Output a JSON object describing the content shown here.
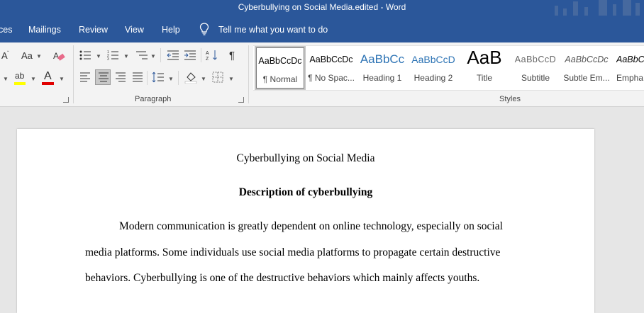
{
  "window": {
    "title": "Cyberbullying on Social Media.edited  -  Word"
  },
  "menu": {
    "tabs": [
      "ces",
      "Mailings",
      "Review",
      "View",
      "Help"
    ],
    "tell_me": "Tell me what you want to do"
  },
  "ribbon": {
    "font": {
      "grow_shrink_glyph": "A",
      "change_case_glyph": "Aa",
      "highlight_glyph": "ab",
      "font_color_glyph": "A",
      "highlight_color": "#ffff00",
      "font_color": "#e00000"
    },
    "paragraph": {
      "label": "Paragraph",
      "show_marks_glyph": "¶"
    },
    "styles": {
      "label": "Styles",
      "items": [
        {
          "sample": "AaBbCcDc",
          "name": "¶ Normal"
        },
        {
          "sample": "AaBbCcDc",
          "name": "¶ No Spac..."
        },
        {
          "sample": "AaBbCc",
          "name": "Heading 1"
        },
        {
          "sample": "AaBbCcD",
          "name": "Heading 2"
        },
        {
          "sample": "AaB",
          "name": "Title"
        },
        {
          "sample": "AaBbCcD",
          "name": "Subtitle"
        },
        {
          "sample": "AaBbCcDc",
          "name": "Subtle Em..."
        },
        {
          "sample": "AaBbCcDc",
          "name": "Empha"
        }
      ]
    }
  },
  "document": {
    "title": "Cyberbullying on Social Media",
    "heading": "Description of cyberbullying",
    "paragraph_lines": [
      "Modern communication is greatly dependent on online technology, especially on social",
      "media platforms. Some individuals use social media platforms to propagate certain destructive",
      "behaviors. Cyberbullying is one of the destructive behaviors which mainly affects youths."
    ]
  },
  "colors": {
    "title_bar": "#2b579a",
    "ribbon_bg": "#f3f3f3",
    "doc_bg": "#e6e6e6",
    "heading_style_color": "#2e74b5"
  }
}
